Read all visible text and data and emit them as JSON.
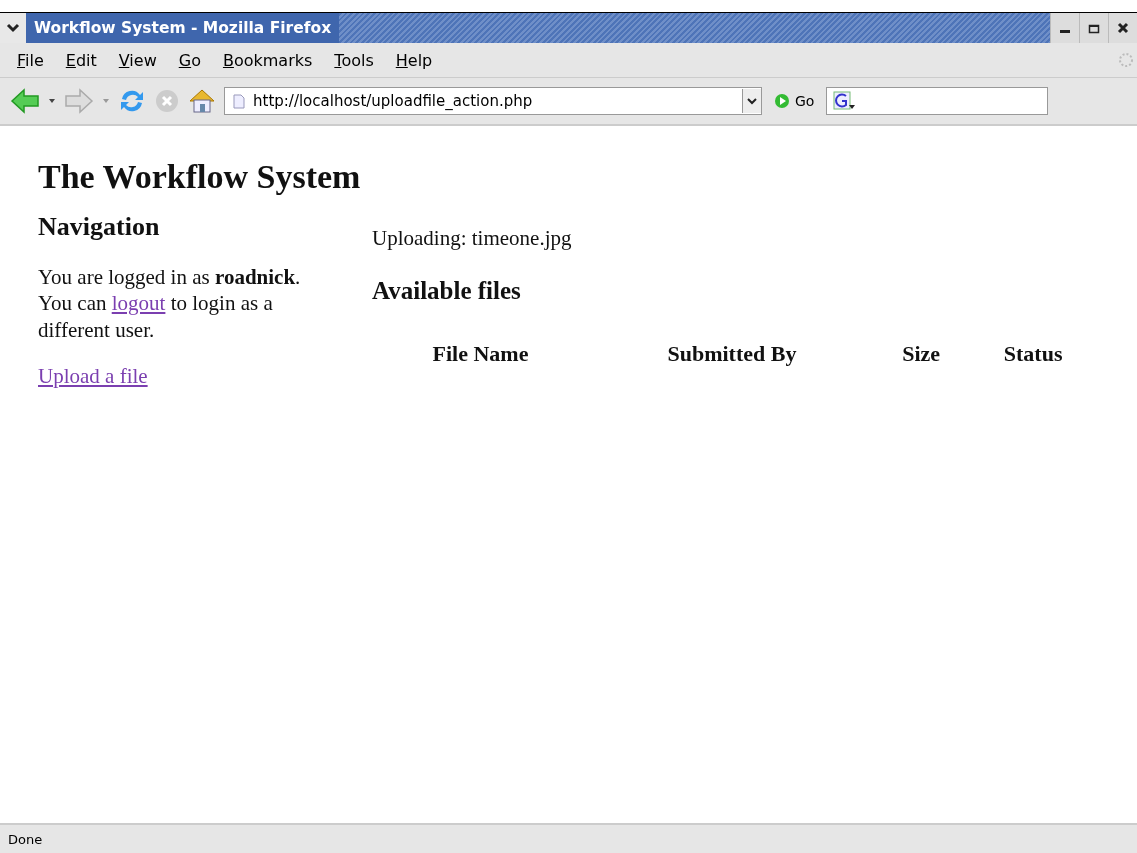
{
  "window": {
    "title": "Workflow System - Mozilla Firefox"
  },
  "menu": [
    "File",
    "Edit",
    "View",
    "Go",
    "Bookmarks",
    "Tools",
    "Help"
  ],
  "toolbar": {
    "url": "http://localhost/uploadfile_action.php",
    "go_label": "Go"
  },
  "page": {
    "heading": "The Workflow System",
    "navigation": {
      "heading": "Navigation",
      "text_before": "You are logged in as **roadnick**. You can ",
      "link": "logout",
      "text_after": " to login as a different user.",
      "upload_link": "Upload a file"
    },
    "main": {
      "message": "Uploading: timeone.jpg",
      "heading": "Available files",
      "columns": [
        "File Name",
        "Submitted By",
        "Size",
        "Status"
      ]
    }
  },
  "status_bar": {
    "text": "Done"
  }
}
